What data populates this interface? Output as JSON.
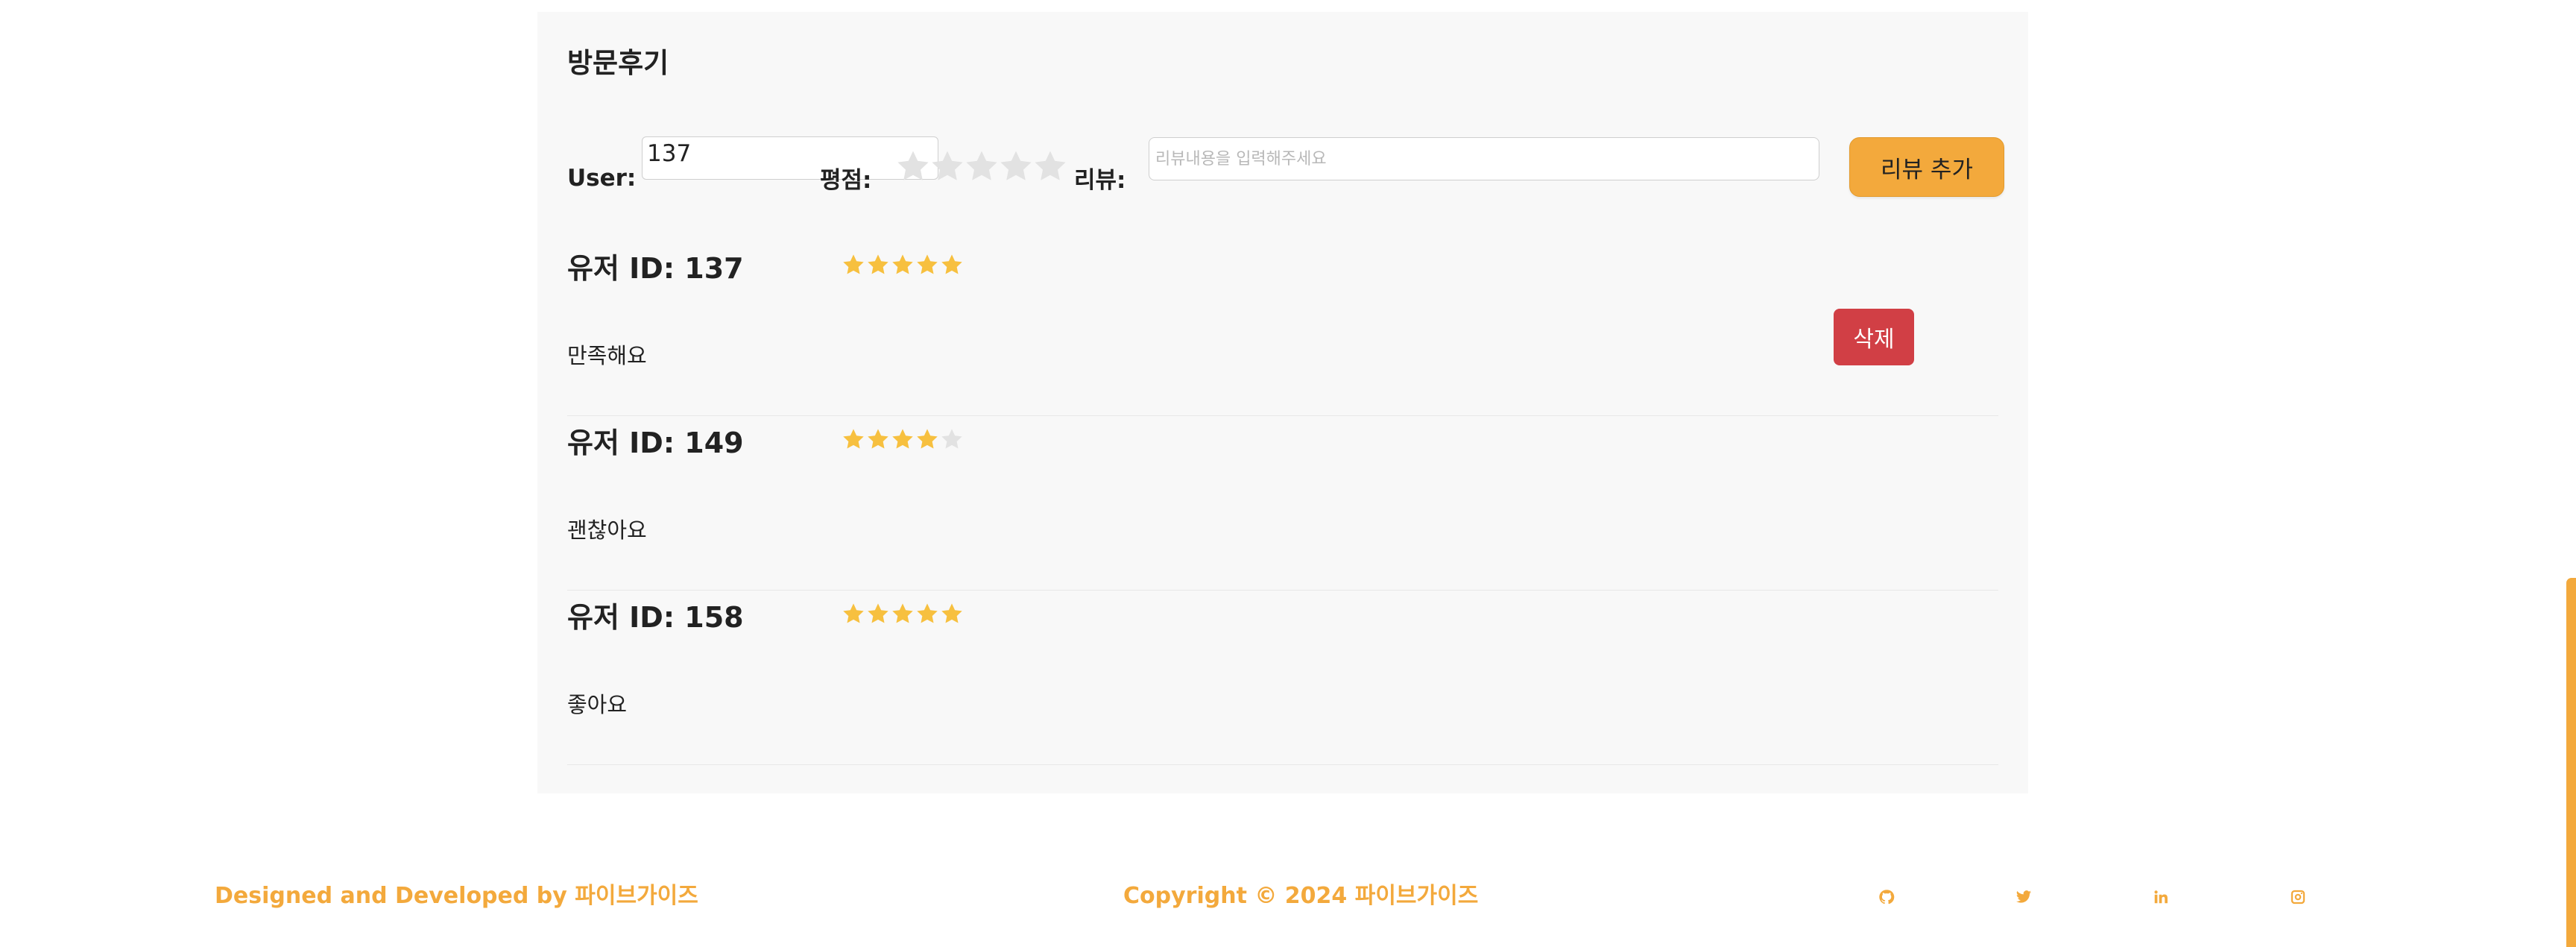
{
  "reviews_section": {
    "title": "방문후기",
    "form": {
      "user_label": "User:",
      "user_value": "137",
      "rating_label": "평점:",
      "rating_value": 0,
      "review_label": "리뷰:",
      "review_placeholder": "리뷰내용을 입력해주세요",
      "add_button_label": "리뷰 추가"
    },
    "reviews": [
      {
        "user_id_label": "유저 ID: 137",
        "rating": 5,
        "content": "만족해요",
        "delete_label": "삭제"
      },
      {
        "user_id_label": "유저 ID: 149",
        "rating": 4,
        "content": "괜찮아요"
      },
      {
        "user_id_label": "유저 ID: 158",
        "rating": 5,
        "content": "좋아요"
      }
    ]
  },
  "footer": {
    "left_text": "Designed and Developed by 파이브가이즈",
    "center_text": "Copyright © 2024 파이브가이즈",
    "social_icons": [
      "github-icon",
      "twitter-icon",
      "linkedin-icon",
      "instagram-icon"
    ]
  },
  "colors": {
    "accent": "#f3a93c",
    "danger": "#d13f45",
    "star_filled": "#f7c03f",
    "star_empty": "#e2e2e2",
    "panel_bg": "#f8f8f8"
  }
}
